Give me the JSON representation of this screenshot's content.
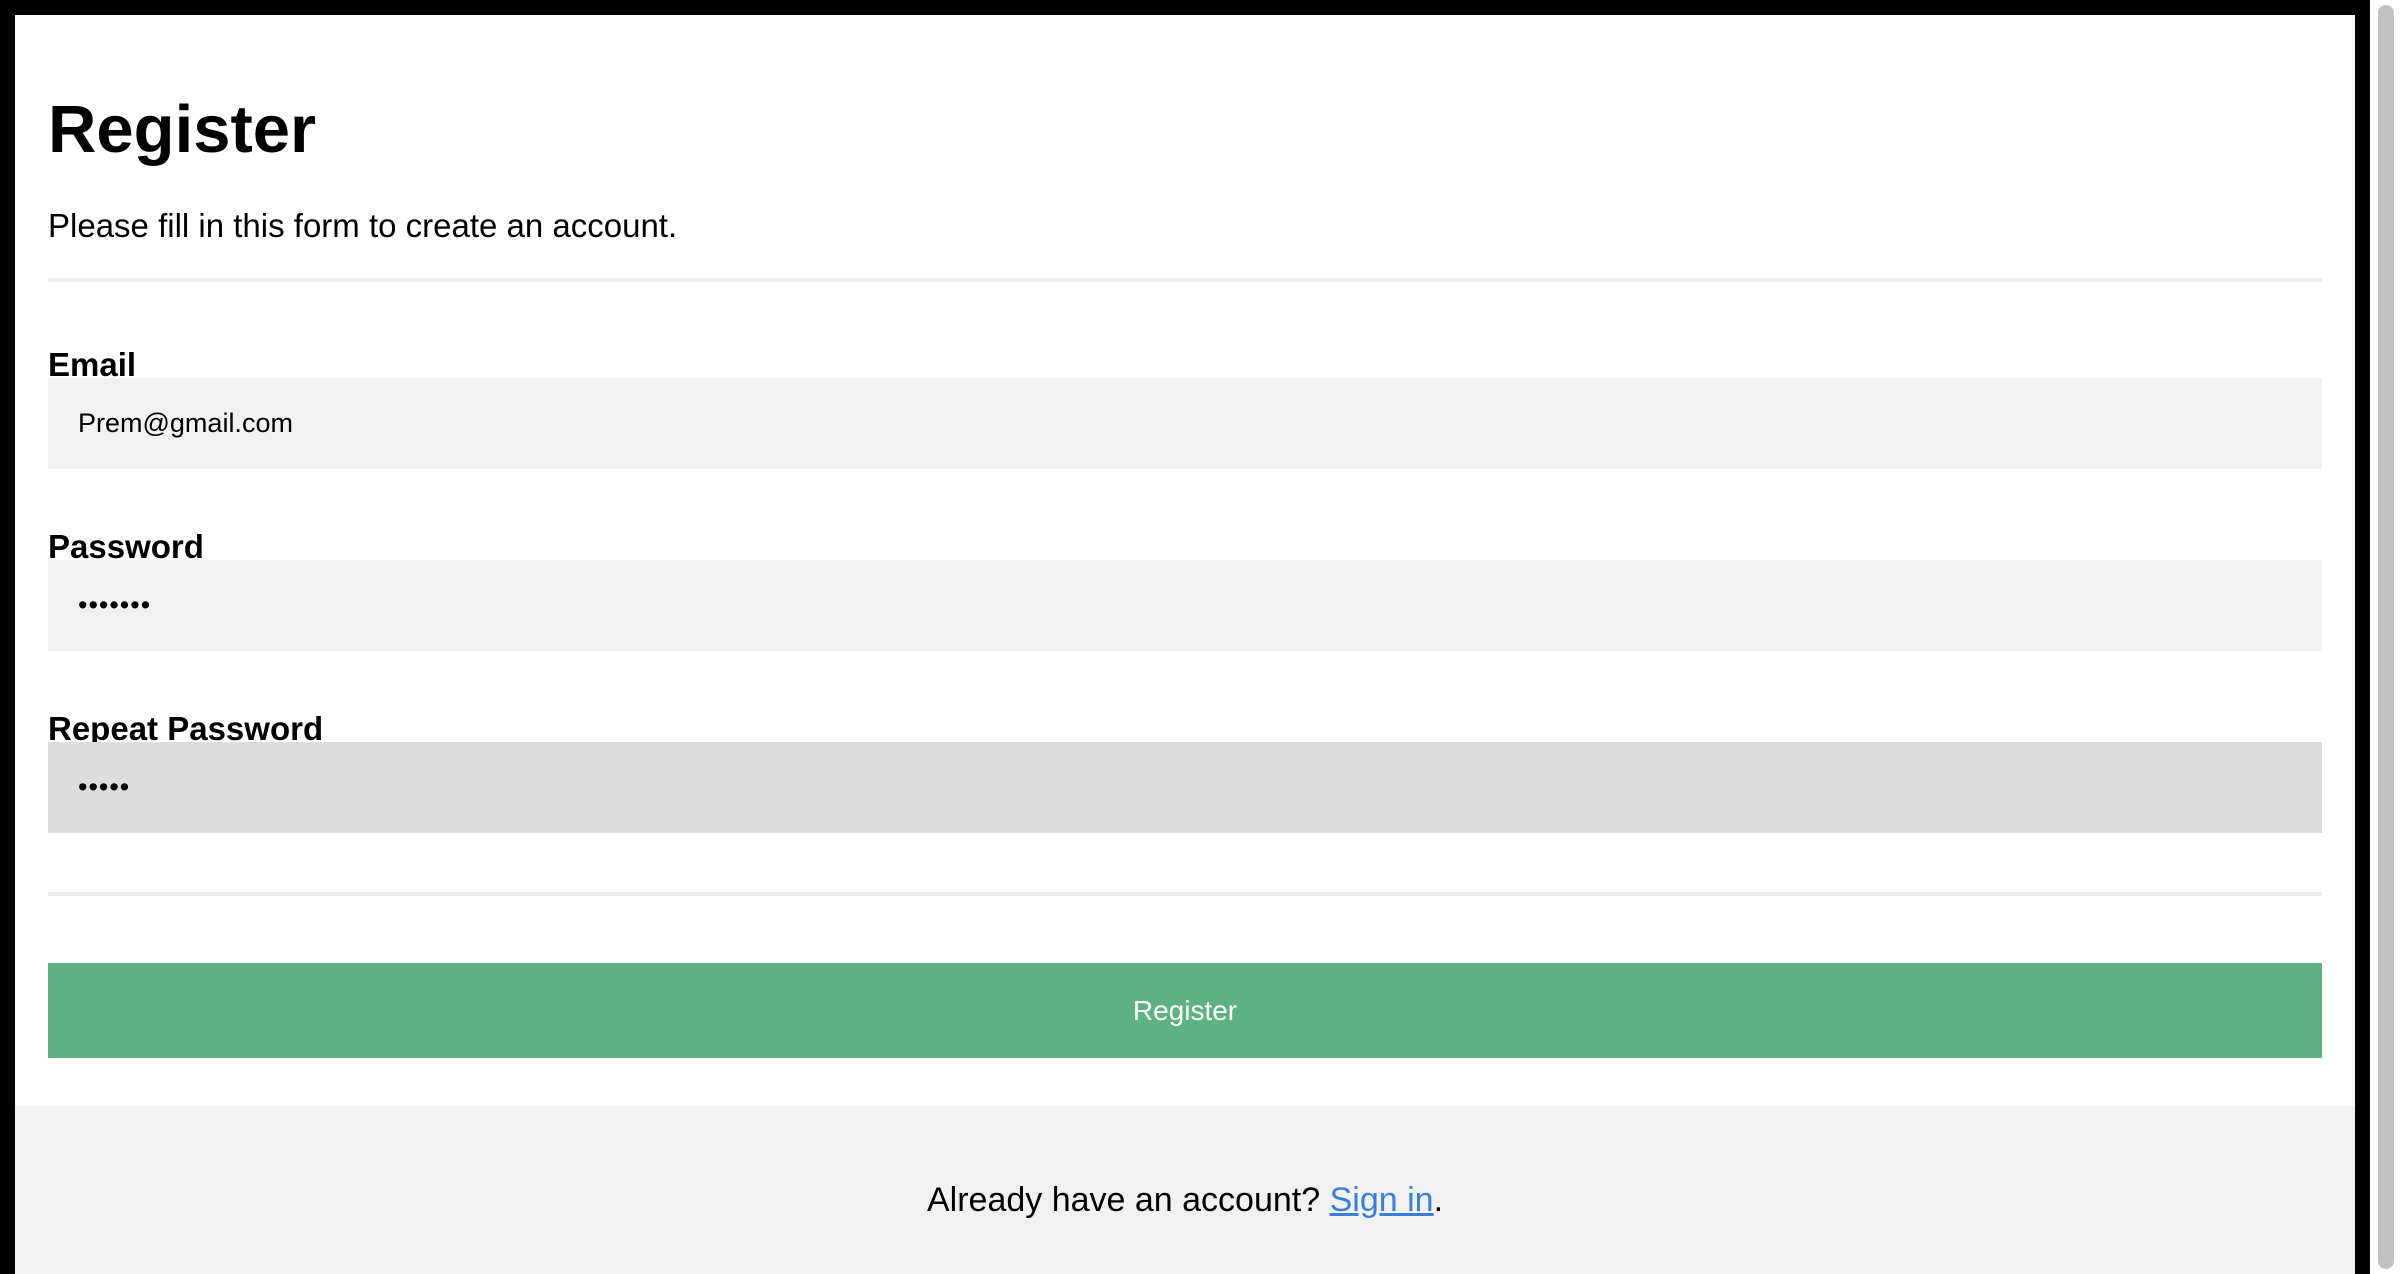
{
  "form": {
    "title": "Register",
    "subtitle": "Please fill in this form to create an account.",
    "email": {
      "label": "Email",
      "value": "Prem@gmail.com"
    },
    "password": {
      "label": "Password",
      "value": "•••••••"
    },
    "repeat_password": {
      "label": "Repeat Password",
      "value": "•••••"
    },
    "submit_label": "Register"
  },
  "footer": {
    "prompt": "Already have an account? ",
    "link_label": "Sign in",
    "suffix": "."
  },
  "colors": {
    "button": "#5eb180",
    "input_bg": "#f1f1f1",
    "input_focused_bg": "#dddddd",
    "link": "#3b7fd9"
  }
}
